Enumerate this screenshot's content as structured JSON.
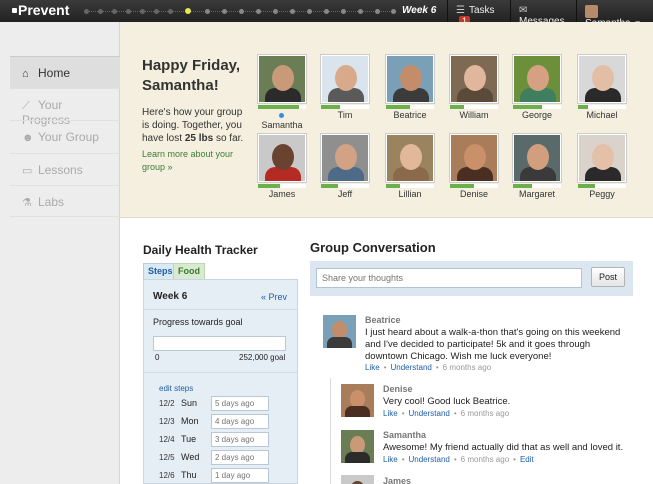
{
  "topbar": {
    "logo": "Prevent",
    "week_label": "Week 6",
    "tasks_label": "Tasks",
    "tasks_count": "1",
    "messages_label": "Messages",
    "user_name": "Samantha"
  },
  "sidebar": {
    "items": [
      {
        "label": "Home",
        "icon": "home-icon"
      },
      {
        "label": "Your Progress",
        "icon": "chart-icon"
      },
      {
        "label": "Your Group",
        "icon": "group-icon"
      },
      {
        "label": "Lessons",
        "icon": "book-icon"
      },
      {
        "label": "Labs",
        "icon": "labs-icon"
      }
    ]
  },
  "hero": {
    "greeting": "Happy Friday, Samantha!",
    "summary_pre": "Here's how your group is doing. Together, you have lost ",
    "summary_bold": "25 lbs",
    "summary_post": " so far.",
    "learn_more": "Learn more about your group »",
    "members": [
      {
        "name": "Samantha",
        "progress": 0.85,
        "online": true,
        "skin": "#c99a78",
        "shirt": "#2b2b2b",
        "bg": "#6a7d55"
      },
      {
        "name": "Tim",
        "progress": 0.4,
        "online": false,
        "skin": "#d9a98b",
        "shirt": "#5a5a5a",
        "bg": "#d9e4ec"
      },
      {
        "name": "Beatrice",
        "progress": 0.5,
        "online": false,
        "skin": "#c38d6b",
        "shirt": "#3b3b3b",
        "bg": "#7aa0b8"
      },
      {
        "name": "William",
        "progress": 0.3,
        "online": false,
        "skin": "#e0b69c",
        "shirt": "#5b4a3a",
        "bg": "#7e6a52"
      },
      {
        "name": "George",
        "progress": 0.6,
        "online": false,
        "skin": "#d6a082",
        "shirt": "#3f7f5f",
        "bg": "#6c8f3a"
      },
      {
        "name": "Michael",
        "progress": 0.2,
        "online": false,
        "skin": "#e2bfa4",
        "shirt": "#2a2a2a",
        "bg": "#d8d8d8"
      },
      {
        "name": "James",
        "progress": 0.45,
        "online": false,
        "skin": "#6a4330",
        "shirt": "#b52a22",
        "bg": "#c9c9c9"
      },
      {
        "name": "Jeff",
        "progress": 0.35,
        "online": false,
        "skin": "#d1a283",
        "shirt": "#4d6a86",
        "bg": "#8f8f8f"
      },
      {
        "name": "Lillian",
        "progress": 0.3,
        "online": false,
        "skin": "#e2b89a",
        "shirt": "#8a6a4a",
        "bg": "#9a8460"
      },
      {
        "name": "Denise",
        "progress": 0.5,
        "online": false,
        "skin": "#c9906a",
        "shirt": "#4a2e22",
        "bg": "#a97d5a"
      },
      {
        "name": "Margaret",
        "progress": 0.4,
        "online": false,
        "skin": "#d29f7e",
        "shirt": "#3a3a3a",
        "bg": "#5a6a6a"
      },
      {
        "name": "Peggy",
        "progress": 0.35,
        "online": false,
        "skin": "#e4c0a8",
        "shirt": "#2a2a2a",
        "bg": "#d9d3cc"
      }
    ]
  },
  "tracker": {
    "title": "Daily Health Tracker",
    "tabs": [
      "Steps",
      "Food"
    ],
    "week": "Week 6",
    "prev": "« Prev",
    "progress_label": "Progress towards goal",
    "goal_progress": 0,
    "goal_min": "0",
    "goal_max": "252,000 goal",
    "edit_steps": "edit steps",
    "days": [
      {
        "date": "12/2",
        "day": "Sun",
        "value": "5 days ago"
      },
      {
        "date": "12/3",
        "day": "Mon",
        "value": "4 days ago"
      },
      {
        "date": "12/4",
        "day": "Tue",
        "value": "3 days ago"
      },
      {
        "date": "12/5",
        "day": "Wed",
        "value": "2 days ago"
      },
      {
        "date": "12/6",
        "day": "Thu",
        "value": "1 day ago"
      }
    ]
  },
  "conversation": {
    "title": "Group Conversation",
    "share_placeholder": "Share your thoughts",
    "post_label": "Post",
    "posts": [
      {
        "name": "Beatrice",
        "text": "I just heard about a walk-a-thon that's going on this weekend and I've decided to participate! 5k and it goes through downtown Chicago. Wish me luck everyone!",
        "like": "Like",
        "understand": "Understand",
        "time": "6 months ago"
      },
      {
        "name": "Denise",
        "text": "Very cool! Good luck Beatrice.",
        "like": "Like",
        "understand": "Understand",
        "time": "6 months ago"
      },
      {
        "name": "Samantha",
        "text": "Awesome! My friend actually did that as well and loved it.",
        "like": "Like",
        "understand": "Understand",
        "time": "6 months ago",
        "edit": "Edit"
      },
      {
        "name": "James"
      }
    ]
  }
}
